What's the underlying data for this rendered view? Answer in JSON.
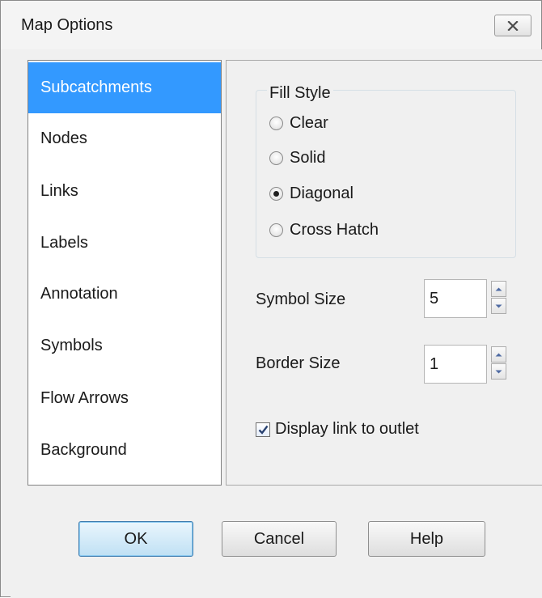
{
  "window": {
    "title": "Map Options"
  },
  "sidebar": {
    "items": [
      {
        "label": "Subcatchments",
        "selected": true
      },
      {
        "label": "Nodes"
      },
      {
        "label": "Links"
      },
      {
        "label": "Labels"
      },
      {
        "label": "Annotation"
      },
      {
        "label": "Symbols"
      },
      {
        "label": "Flow Arrows"
      },
      {
        "label": "Background"
      }
    ]
  },
  "fill_style": {
    "title": "Fill Style",
    "options": [
      {
        "label": "Clear",
        "checked": false
      },
      {
        "label": "Solid",
        "checked": false
      },
      {
        "label": "Diagonal",
        "checked": true
      },
      {
        "label": "Cross Hatch",
        "checked": false
      }
    ]
  },
  "symbol_size": {
    "label": "Symbol Size",
    "value": "5"
  },
  "border_size": {
    "label": "Border Size",
    "value": "1"
  },
  "display_link": {
    "label": "Display link to outlet",
    "checked": true
  },
  "buttons": {
    "ok": "OK",
    "cancel": "Cancel",
    "help": "Help"
  },
  "colors": {
    "selection": "#3399ff",
    "default_button": "#bfe0f4",
    "dialog_bg": "#f0f0f0"
  }
}
